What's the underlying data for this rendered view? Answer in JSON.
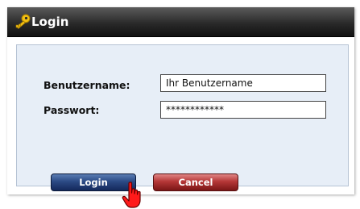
{
  "window": {
    "title": "Login",
    "icon": "key-icon"
  },
  "form": {
    "username_label": "Benutzername:",
    "username_value": "Ihr Benutzername",
    "password_label": "Passwort:",
    "password_value": "************"
  },
  "buttons": {
    "login_label": "Login",
    "cancel_label": "Cancel"
  },
  "cursor": {
    "icon": "hand-pointer-icon"
  },
  "colors": {
    "titlebar": "#2a2a2a",
    "panel": "#e7eef7",
    "login_button": "#2b4a85",
    "cancel_button": "#b53636",
    "cursor": "#ff0000"
  }
}
